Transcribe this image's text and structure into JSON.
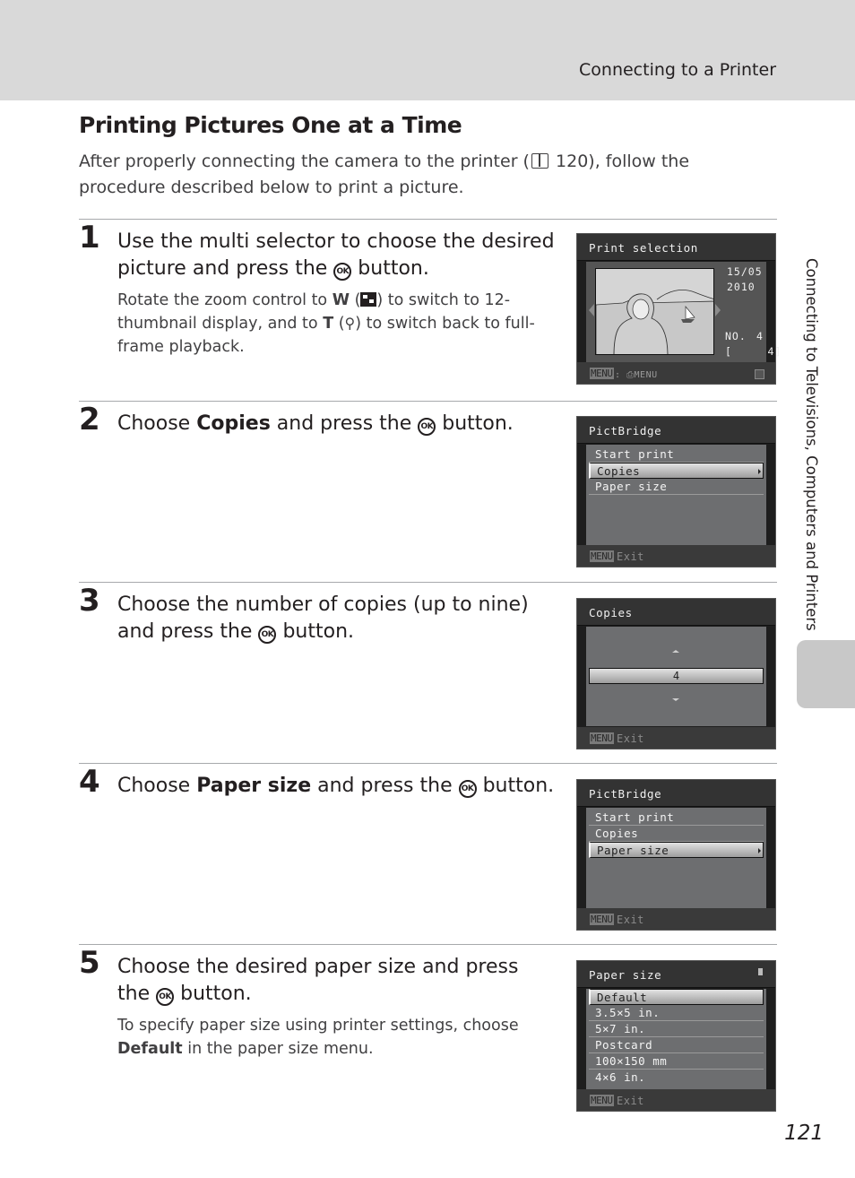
{
  "header": {
    "section": "Connecting to a Printer"
  },
  "page_title": "Printing Pictures One at a Time",
  "intro": {
    "before_ref": "After properly connecting the camera to the printer (",
    "ref_page": "120",
    "after_ref": "), follow the procedure described below to print a picture."
  },
  "side_tab": {
    "label": "Connecting to Televisions, Computers and Printers"
  },
  "page_number": "121",
  "ok_glyph": "OK",
  "steps": [
    {
      "number": "1",
      "title_pre": "Use the multi selector to choose the desired picture and press the ",
      "title_post": " button.",
      "body": {
        "p1": "Rotate the zoom control to ",
        "w": "W",
        "p2": " (",
        "p3": ") to switch to 12-thumbnail display, and to ",
        "t": "T",
        "p4": " (",
        "p5": ") to switch back to full-frame playback."
      },
      "screen": {
        "title": "Print selection",
        "date": "15/05",
        "year": "2010",
        "no_label": "NO.",
        "no_value": "4",
        "count_value": "[     4]",
        "foot_key": "MENU",
        "foot_label": ": ⎙MENU"
      }
    },
    {
      "number": "2",
      "title_pre": "Choose ",
      "title_bold": "Copies",
      "title_mid": " and press the ",
      "title_post": " button.",
      "screen": {
        "title": "PictBridge",
        "items": [
          "Start print",
          "Copies",
          "Paper size"
        ],
        "selected": "Copies",
        "foot_key": "MENU",
        "foot_label": "Exit"
      }
    },
    {
      "number": "3",
      "title_pre": "Choose the number of copies (up to nine) and press the ",
      "title_post": " button.",
      "screen": {
        "title": "Copies",
        "value": "4",
        "foot_key": "MENU",
        "foot_label": "Exit"
      }
    },
    {
      "number": "4",
      "title_pre": "Choose ",
      "title_bold": "Paper size",
      "title_mid": " and press the ",
      "title_post": " button.",
      "screen": {
        "title": "PictBridge",
        "items": [
          "Start print",
          "Copies",
          "Paper size"
        ],
        "selected": "Paper size",
        "foot_key": "MENU",
        "foot_label": "Exit"
      }
    },
    {
      "number": "5",
      "title_pre": "Choose the desired paper size and press the ",
      "title_post": " button.",
      "body": {
        "p1": "To specify paper size using printer settings, choose ",
        "bold": "Default",
        "p2": " in the paper size menu."
      },
      "screen": {
        "title": "Paper size",
        "items": [
          "Default",
          "3.5×5 in.",
          "5×7 in.",
          "Postcard",
          "100×150 mm",
          "4×6 in."
        ],
        "selected": "Default",
        "foot_key": "MENU",
        "foot_label": "Exit"
      }
    }
  ]
}
